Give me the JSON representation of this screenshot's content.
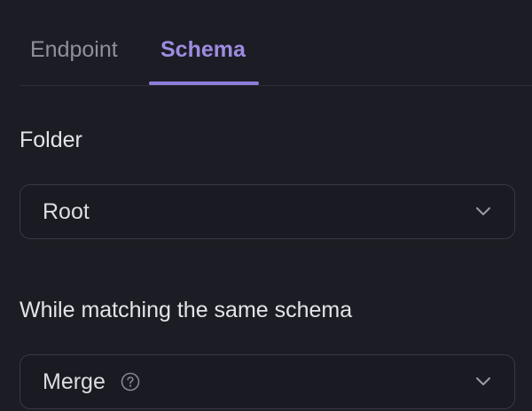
{
  "tabs": [
    {
      "label": "Endpoint",
      "active": false
    },
    {
      "label": "Schema",
      "active": true
    }
  ],
  "folder": {
    "label": "Folder",
    "value": "Root",
    "icon": "chevron-down-icon"
  },
  "matching": {
    "label": "While matching the same schema",
    "value": "Merge",
    "help_icon": "question-circle-icon",
    "icon": "chevron-down-icon"
  },
  "colors": {
    "background": "#1c1c24",
    "accent": "#8e7ed8",
    "text": "#e3e4e8",
    "muted": "#8f909a",
    "border": "#373845"
  }
}
